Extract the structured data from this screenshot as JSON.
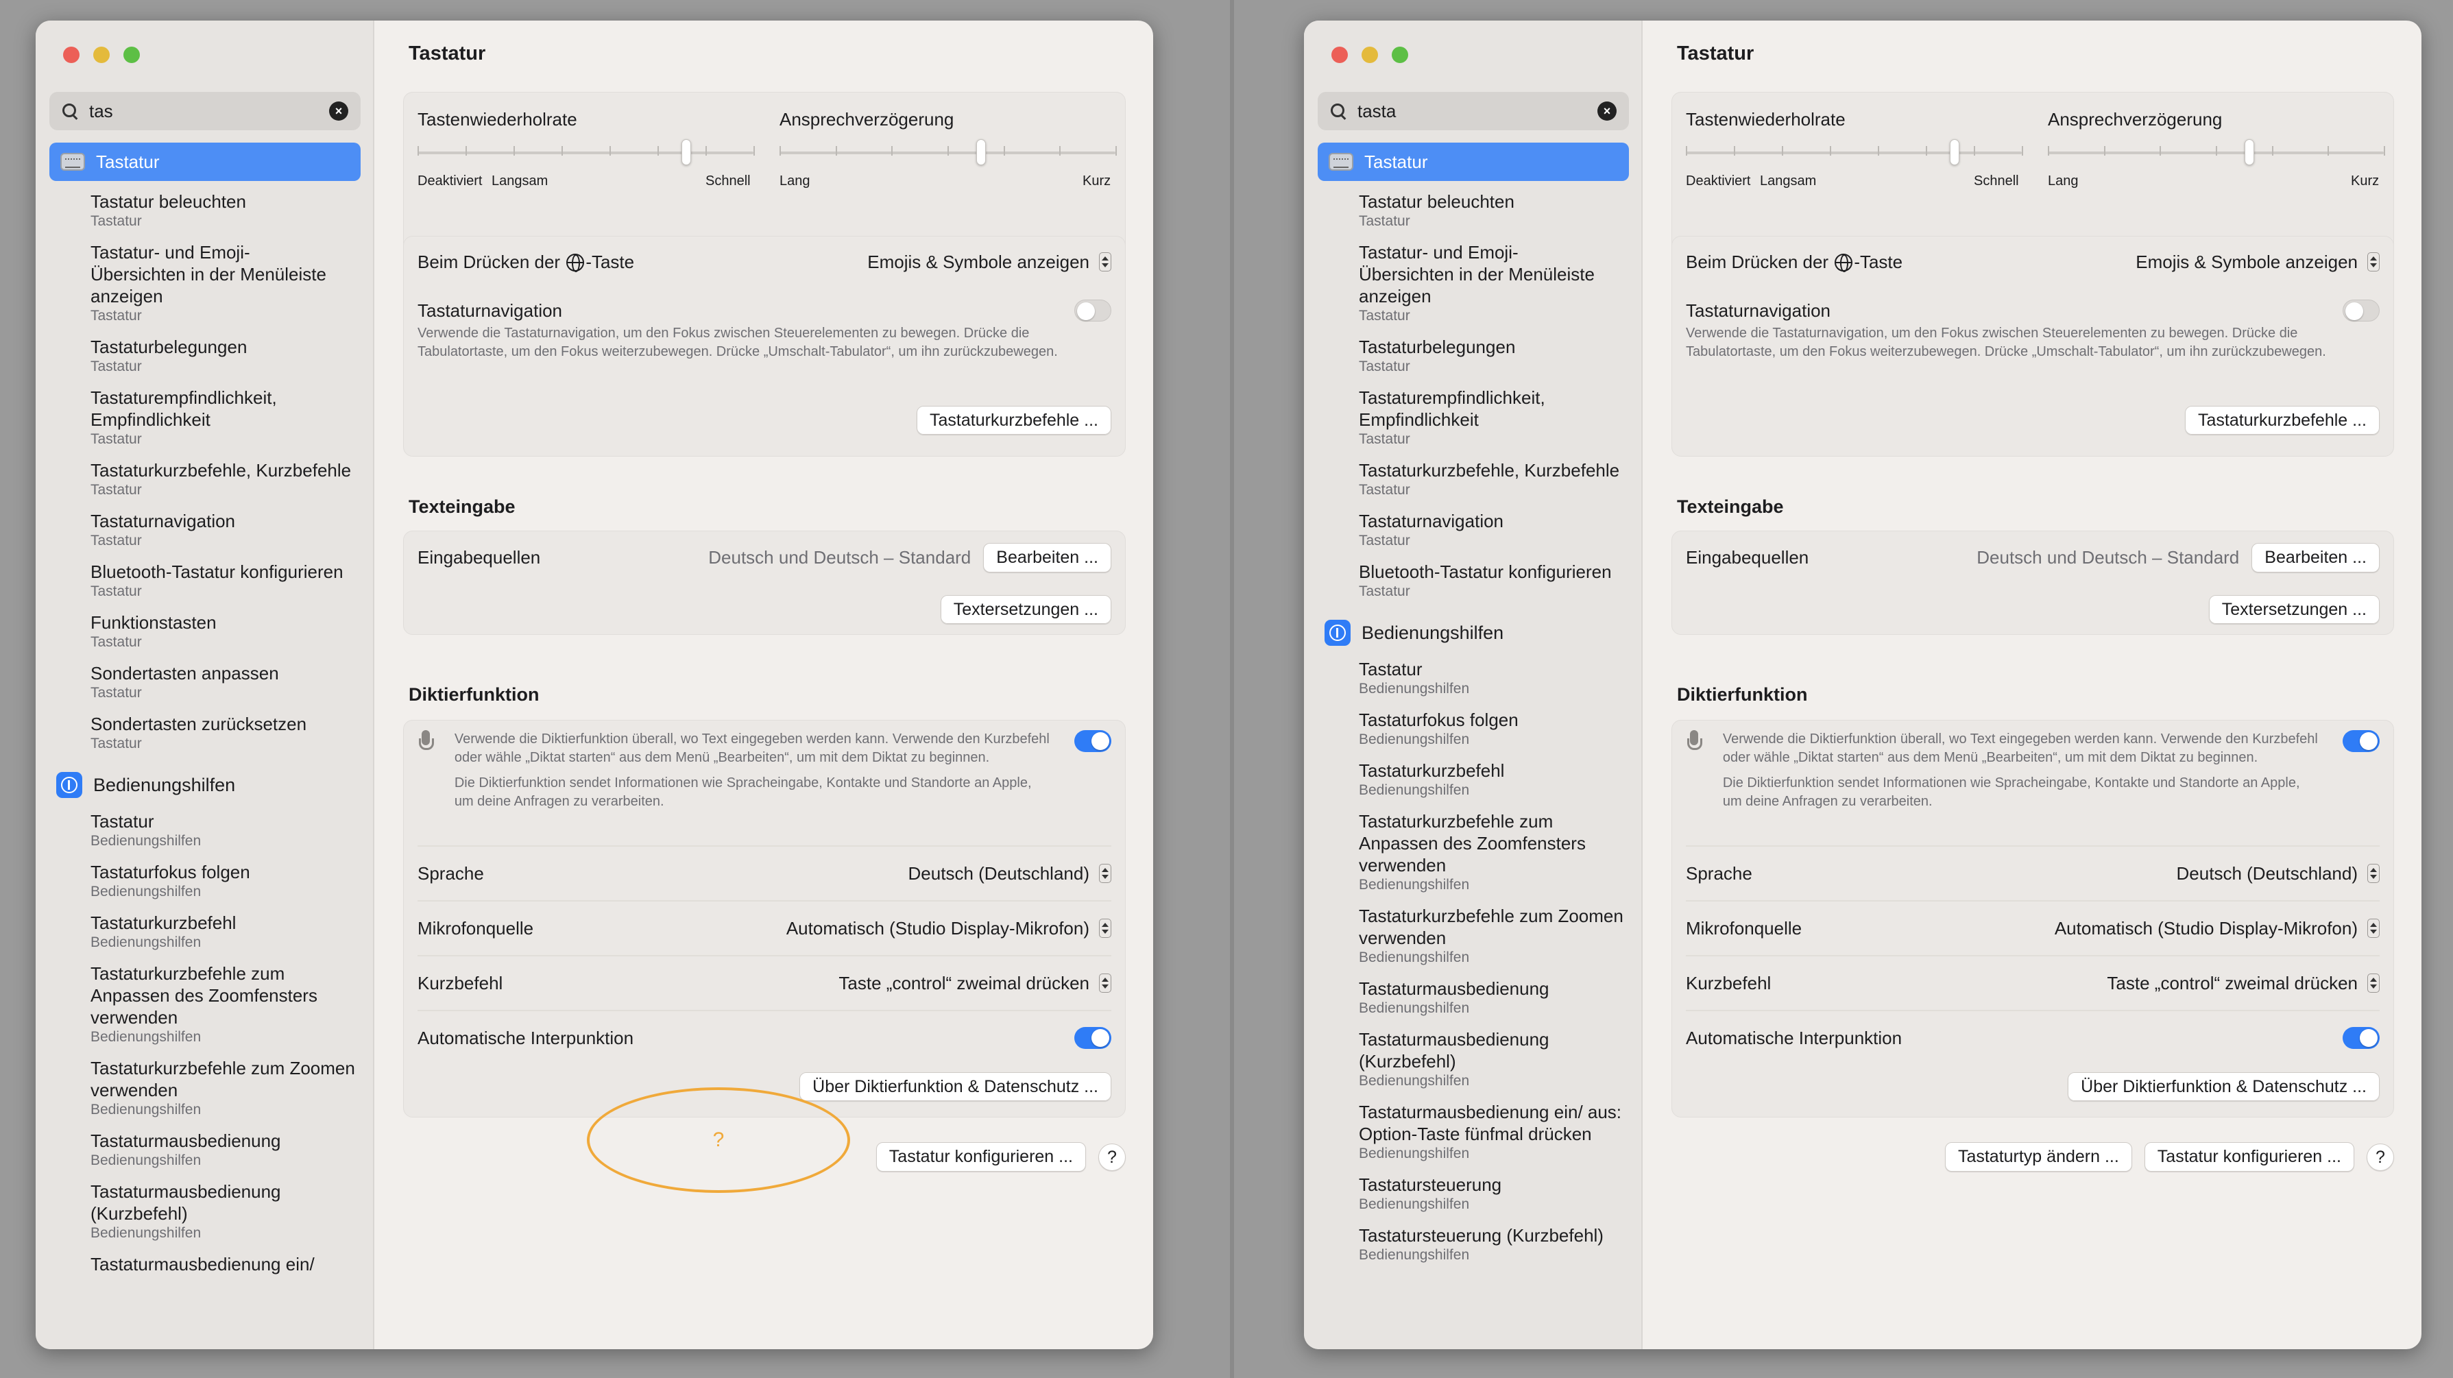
{
  "left": {
    "search_value": "tas",
    "results": [
      {
        "title": "Tastatur beleuchten",
        "sub": "Tastatur"
      },
      {
        "title": "Tastatur- und Emoji-\nÜbersichten in der Menüleiste anzeigen",
        "sub": "Tastatur"
      },
      {
        "title": "Tastaturbelegungen",
        "sub": "Tastatur"
      },
      {
        "title": "Tastaturempfindlichkeit, Empfindlichkeit",
        "sub": "Tastatur"
      },
      {
        "title": "Tastaturkurzbefehle, Kurzbefehle",
        "sub": "Tastatur"
      },
      {
        "title": "Tastaturnavigation",
        "sub": "Tastatur"
      },
      {
        "title": "Bluetooth-Tastatur konfigurieren",
        "sub": "Tastatur"
      },
      {
        "title": "Funktionstasten",
        "sub": "Tastatur"
      },
      {
        "title": "Sondertasten anpassen",
        "sub": "Tastatur"
      },
      {
        "title": "Sondertasten zurücksetzen",
        "sub": "Tastatur"
      }
    ],
    "a11y_results": [
      {
        "title": "Tastatur",
        "sub": "Bedienungshilfen"
      },
      {
        "title": "Tastaturfokus folgen",
        "sub": "Bedienungshilfen"
      },
      {
        "title": "Tastaturkurzbefehl",
        "sub": "Bedienungshilfen"
      },
      {
        "title": "Tastaturkurzbefehle zum Anpassen des Zoomfensters verwenden",
        "sub": "Bedienungshilfen"
      },
      {
        "title": "Tastaturkurzbefehle zum Zoomen verwenden",
        "sub": "Bedienungshilfen"
      },
      {
        "title": "Tastaturmausbedienung",
        "sub": "Bedienungshilfen"
      },
      {
        "title": "Tastaturmausbedienung (Kurzbefehl)",
        "sub": "Bedienungshilfen"
      },
      {
        "title": "Tastaturmausbedienung ein/",
        "sub": ""
      }
    ],
    "bottom_buttons": {
      "help_marker": "?",
      "configure": "Tastatur konfigurieren ...",
      "help": "?"
    }
  },
  "right": {
    "search_value": "tasta",
    "results": [
      {
        "title": "Tastatur beleuchten",
        "sub": "Tastatur"
      },
      {
        "title": "Tastatur- und Emoji-\nÜbersichten in der Menüleiste anzeigen",
        "sub": "Tastatur"
      },
      {
        "title": "Tastaturbelegungen",
        "sub": "Tastatur"
      },
      {
        "title": "Tastaturempfindlichkeit, Empfindlichkeit",
        "sub": "Tastatur"
      },
      {
        "title": "Tastaturkurzbefehle, Kurzbefehle",
        "sub": "Tastatur"
      },
      {
        "title": "Tastaturnavigation",
        "sub": "Tastatur"
      },
      {
        "title": "Bluetooth-Tastatur konfigurieren",
        "sub": "Tastatur"
      }
    ],
    "a11y_results": [
      {
        "title": "Tastatur",
        "sub": "Bedienungshilfen"
      },
      {
        "title": "Tastaturfokus folgen",
        "sub": "Bedienungshilfen"
      },
      {
        "title": "Tastaturkurzbefehl",
        "sub": "Bedienungshilfen"
      },
      {
        "title": "Tastaturkurzbefehle zum Anpassen des Zoomfensters verwenden",
        "sub": "Bedienungshilfen"
      },
      {
        "title": "Tastaturkurzbefehle zum Zoomen verwenden",
        "sub": "Bedienungshilfen"
      },
      {
        "title": "Tastaturmausbedienung",
        "sub": "Bedienungshilfen"
      },
      {
        "title": "Tastaturmausbedienung (Kurzbefehl)",
        "sub": "Bedienungshilfen"
      },
      {
        "title": "Tastaturmausbedienung ein/ aus: Option-Taste fünfmal drücken",
        "sub": "Bedienungshilfen"
      },
      {
        "title": "Tastatursteuerung",
        "sub": "Bedienungshilfen"
      },
      {
        "title": "Tastatursteuerung (Kurzbefehl)",
        "sub": "Bedienungshilfen"
      }
    ],
    "bottom_buttons": {
      "change_type": "Tastaturtyp ändern ...",
      "configure": "Tastatur konfigurieren ...",
      "help": "?"
    }
  },
  "common": {
    "selected_item": "Tastatur",
    "a11y_group": "Bedienungshilfen",
    "page_title": "Tastatur",
    "repeat_rate_label": "Tastenwiederholrate",
    "repeat_rate_min1": "Deaktiviert",
    "repeat_rate_min2": "Langsam",
    "repeat_rate_max": "Schnell",
    "repeat_rate_level": 0.8,
    "delay_label": "Ansprechverzögerung",
    "delay_min": "Lang",
    "delay_max": "Kurz",
    "delay_level": 0.6,
    "globe_pre": "Beim Drücken der ",
    "globe_post": "-Taste",
    "globe_value": "Emojis & Symbole anzeigen",
    "nav_title": "Tastaturnavigation",
    "nav_desc": "Verwende die Tastaturnavigation, um den Fokus zwischen Steuerelementen zu bewegen. Drücke die Tabulatortaste, um den Fokus weiterzubewegen. Drücke „Umschalt-Tabulator“, um ihn zurückzubewegen.",
    "nav_enabled": false,
    "shortcuts_btn": "Tastaturkurzbefehle ...",
    "text_section": "Texteingabe",
    "sources_label": "Eingabequellen",
    "sources_value": "Deutsch und Deutsch – Standard",
    "edit_btn": "Bearbeiten ...",
    "replace_btn": "Textersetzungen ...",
    "dict_section": "Diktierfunktion",
    "dict_desc1": "Verwende die Diktierfunktion überall, wo Text eingegeben werden kann. Verwende den Kurzbefehl oder wähle „Diktat starten“ aus dem Menü „Bearbeiten“, um mit dem Diktat zu beginnen.",
    "dict_desc2": "Die Diktierfunktion sendet Informationen wie Spracheingabe, Kontakte und Standorte an Apple, um deine Anfragen zu verarbeiten.",
    "dict_enabled": true,
    "lang_label": "Sprache",
    "lang_value": "Deutsch (Deutschland)",
    "mic_label": "Mikrofonquelle",
    "mic_value": "Automatisch (Studio Display-Mikrofon)",
    "shortcut_label": "Kurzbefehl",
    "shortcut_value": "Taste „control“ zweimal drücken",
    "punct_label": "Automatische Interpunktion",
    "punct_enabled": true,
    "privacy_btn": "Über Diktierfunktion & Datenschutz ..."
  },
  "colors": {
    "accent": "#2f7cf6",
    "selection": "#4d8ef5",
    "annotation": "#f0a93a"
  }
}
